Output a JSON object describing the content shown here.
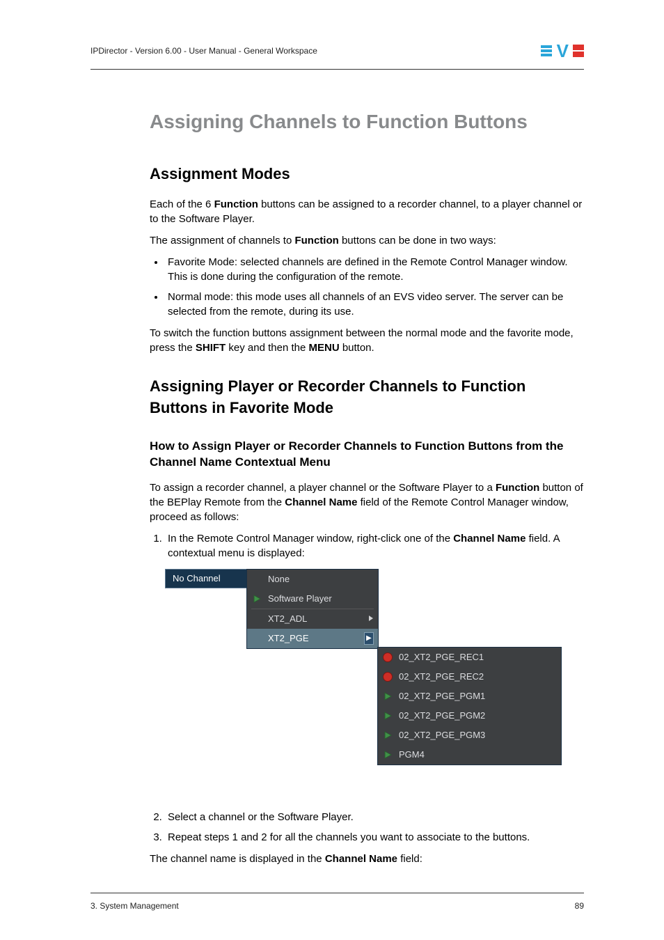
{
  "header": {
    "text": "IPDirector - Version 6.00 - User Manual - General Workspace"
  },
  "title": "Assigning Channels to Function Buttons",
  "s1": {
    "h": "Assignment Modes",
    "p1a": "Each of the 6 ",
    "p1b": "Function",
    "p1c": " buttons can be assigned to a recorder channel, to a player channel or to the Software Player.",
    "p2a": "The assignment of channels to ",
    "p2b": "Function",
    "p2c": " buttons can be done in two ways:",
    "li1": "Favorite Mode: selected channels are defined in the Remote Control Manager window. This is done during the configuration of the remote.",
    "li2": "Normal mode: this mode uses all channels of an EVS video server. The server can be selected from the remote, during its use.",
    "p3a": "To switch the function buttons assignment between the normal mode and the favorite mode, press the ",
    "p3b": "SHIFT",
    "p3c": " key and then the ",
    "p3d": "MENU",
    "p3e": " button."
  },
  "s2": {
    "h": "Assigning Player or Recorder Channels to Function Buttons in Favorite Mode",
    "h3": "How to Assign Player or Recorder Channels to Function Buttons from the Channel Name Contextual Menu",
    "p1a": "To assign a recorder channel, a player channel or the Software Player to a ",
    "p1b": "Function",
    "p1c": " button of the BEPlay Remote from the ",
    "p1d": "Channel Name",
    "p1e": " field of the Remote Control Manager window, proceed as follows:",
    "li1a": "In the Remote Control Manager window, right-click one of the ",
    "li1b": "Channel Name",
    "li1c": " field. A contextual menu is displayed:",
    "li2": "Select a channel or the Software Player.",
    "li3": "Repeat steps 1 and 2 for all the channels you want to associate to the buttons.",
    "p2a": "The channel name is displayed in the ",
    "p2b": "Channel Name",
    "p2c": " field:"
  },
  "menu": {
    "nochannel": "No Channel",
    "none": "None",
    "swplayer": "Software Player",
    "xt2adl": "XT2_ADL",
    "xt2pge": "XT2_PGE",
    "sub": {
      "rec1": "02_XT2_PGE_REC1",
      "rec2": "02_XT2_PGE_REC2",
      "pgm1": "02_XT2_PGE_PGM1",
      "pgm2": "02_XT2_PGE_PGM2",
      "pgm3": "02_XT2_PGE_PGM3",
      "pgm4": "PGM4"
    }
  },
  "footer": {
    "left": "3. System Management",
    "right": "89"
  }
}
